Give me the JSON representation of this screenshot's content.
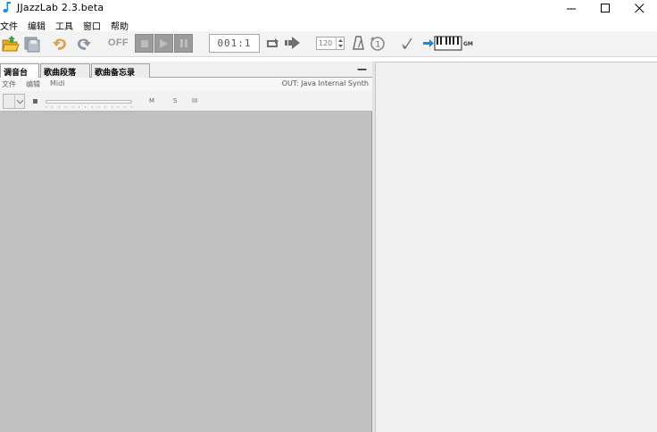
{
  "window": {
    "title": "JJazzLab  2.3.beta",
    "accent_color": "#1e88e5"
  },
  "menubar": {
    "items": [
      "文件",
      "编辑",
      "工具",
      "窗口",
      "帮助"
    ]
  },
  "toolbar": {
    "off_label": "OFF",
    "position": "001:1",
    "tempo": "120",
    "gm_label": "GM",
    "icons": [
      "open-folder-icon",
      "save-icon",
      "undo-icon",
      "redo-icon",
      "stop-icon",
      "play-icon",
      "pause-icon",
      "loop-icon",
      "forward-icon",
      "metronome-icon",
      "precount-icon",
      "note-icon",
      "midi-keyboard-icon"
    ]
  },
  "left_panel": {
    "tabs": [
      "调音台",
      "歌曲段落",
      "歌曲备忘录"
    ],
    "minimize": "—",
    "submenu": [
      "文件",
      "编辑",
      "Midi"
    ],
    "out_label": "OUT: Java Internal Synth",
    "track": {
      "mute": "M",
      "solo": "S",
      "third": "III"
    },
    "background": "#c0c0c0"
  },
  "right_panel": {
    "background": "#f0f0f0"
  }
}
